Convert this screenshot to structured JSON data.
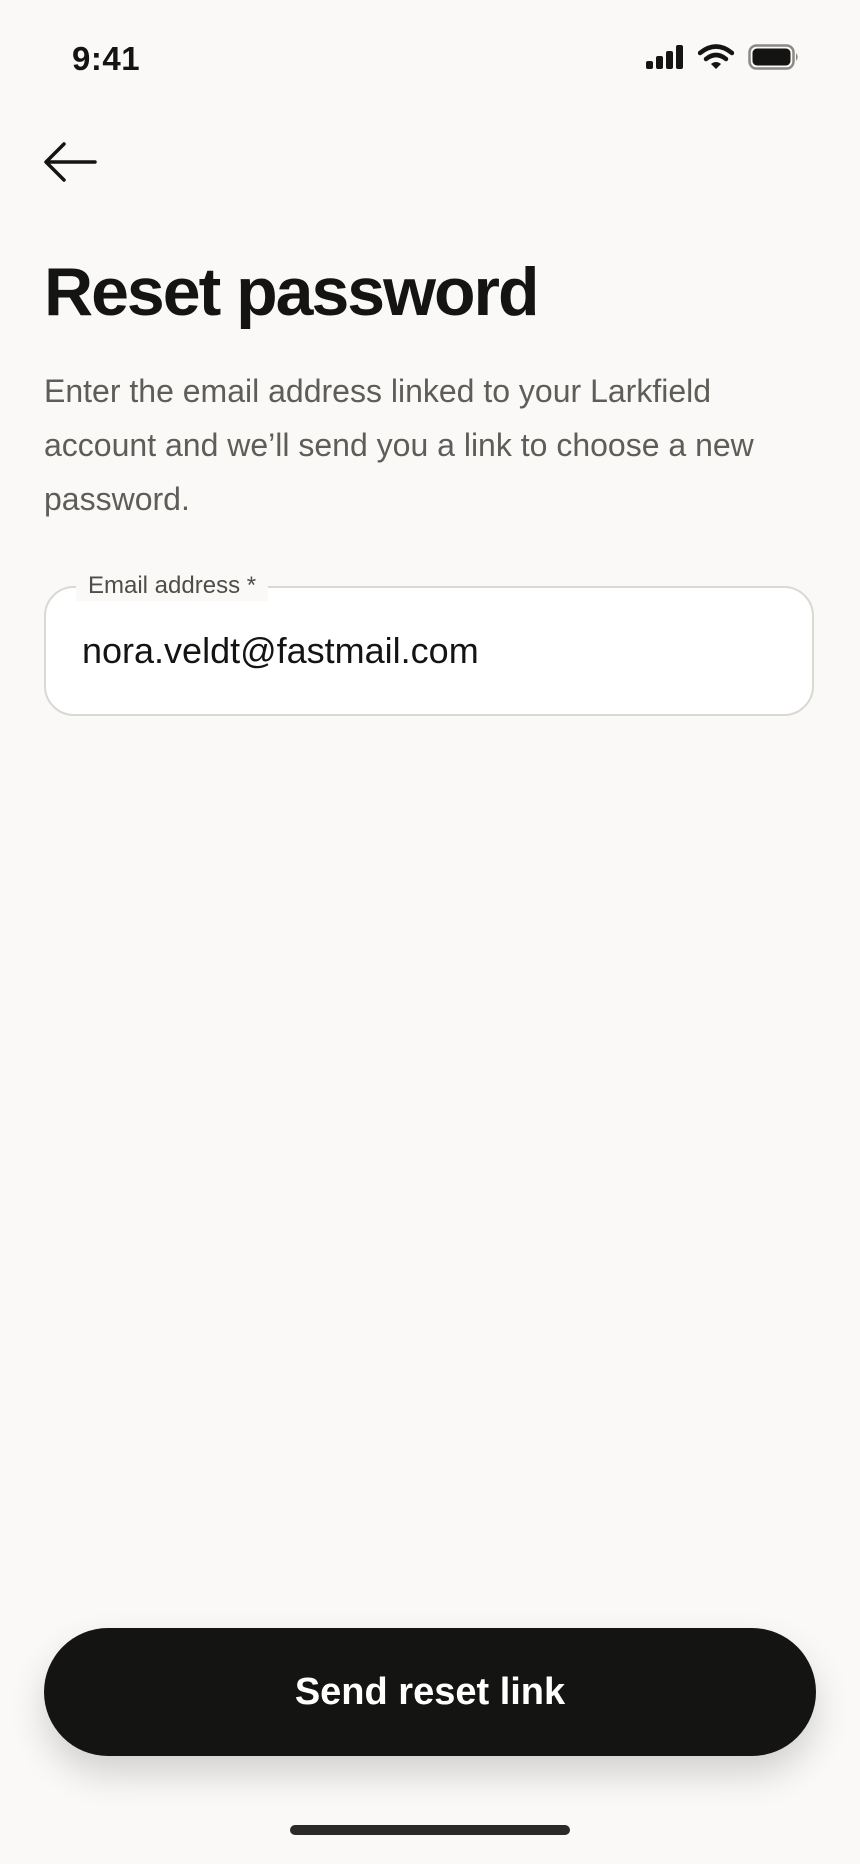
{
  "status_bar": {
    "time": "9:41",
    "icons": [
      "cellular-signal-icon",
      "wifi-icon",
      "battery-icon"
    ]
  },
  "nav": {
    "back_icon": "arrow-left-icon"
  },
  "page": {
    "title": "Reset password",
    "description": "Enter the email address linked to your Larkfield account and we’ll send you a link to choose a new password."
  },
  "email_field": {
    "label": "Email address *",
    "value": "nora.veldt@fastmail.com"
  },
  "actions": {
    "submit_label": "Send reset link"
  },
  "colors": {
    "background": "#FAF9F7",
    "text_primary": "#141412",
    "text_secondary": "#5F5D58",
    "button_bg": "#141412",
    "field_border": "#DAD8D3"
  }
}
